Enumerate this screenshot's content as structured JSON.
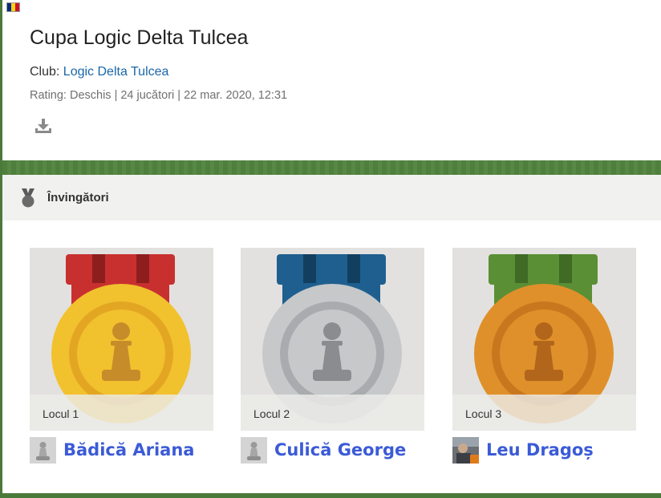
{
  "tournament": {
    "title": "Cupa Logic Delta Tulcea",
    "club_prefix": "Club: ",
    "club_name": "Logic Delta Tulcea",
    "meta": "Rating: Deschis | 24 jucători | 22 mar. 2020, 12:31"
  },
  "flag": {
    "name": "romania-flag",
    "colors": [
      "#002b7f",
      "#fcd116",
      "#ce1126"
    ]
  },
  "winners": {
    "header_label": "Învingători",
    "places": [
      {
        "place_label": "Locul 1",
        "player_name": "Bădică Ariana",
        "avatar": "pawn-avatar",
        "medal": {
          "ribbon": "#c8302f",
          "ribbon_stripe": "#8e1e1e",
          "outer": "#f2c12e",
          "inner": "#e3a623",
          "pawn": "#c68c2a"
        }
      },
      {
        "place_label": "Locul 2",
        "player_name": "Culică George",
        "avatar": "pawn-avatar",
        "medal": {
          "ribbon": "#1e5f8f",
          "ribbon_stripe": "#123f5f",
          "outer": "#c6c8ca",
          "inner": "#a9abae",
          "pawn": "#8a8c8f"
        }
      },
      {
        "place_label": "Locul 3",
        "player_name": "Leu Dragoș",
        "avatar": "photo-avatar",
        "medal": {
          "ribbon": "#5a8f35",
          "ribbon_stripe": "#3f6b24",
          "outer": "#e0902a",
          "inner": "#c9771f",
          "pawn": "#b1661b"
        }
      }
    ]
  }
}
